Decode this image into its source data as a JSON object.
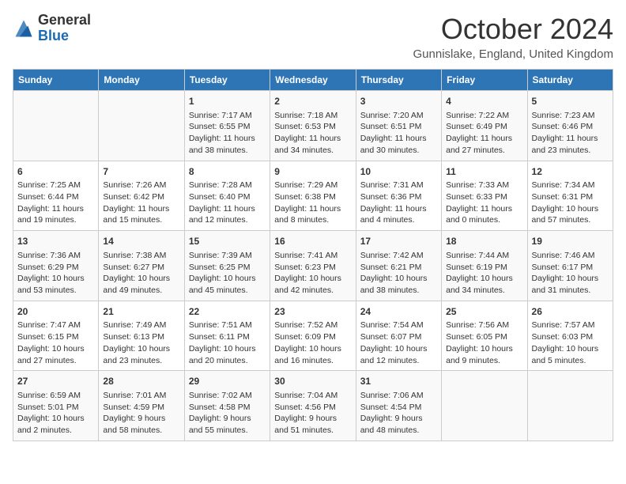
{
  "header": {
    "logo_line1": "General",
    "logo_line2": "Blue",
    "month": "October 2024",
    "location": "Gunnislake, England, United Kingdom"
  },
  "days_of_week": [
    "Sunday",
    "Monday",
    "Tuesday",
    "Wednesday",
    "Thursday",
    "Friday",
    "Saturday"
  ],
  "weeks": [
    [
      {
        "day": "",
        "info": ""
      },
      {
        "day": "",
        "info": ""
      },
      {
        "day": "1",
        "info": "Sunrise: 7:17 AM\nSunset: 6:55 PM\nDaylight: 11 hours and 38 minutes."
      },
      {
        "day": "2",
        "info": "Sunrise: 7:18 AM\nSunset: 6:53 PM\nDaylight: 11 hours and 34 minutes."
      },
      {
        "day": "3",
        "info": "Sunrise: 7:20 AM\nSunset: 6:51 PM\nDaylight: 11 hours and 30 minutes."
      },
      {
        "day": "4",
        "info": "Sunrise: 7:22 AM\nSunset: 6:49 PM\nDaylight: 11 hours and 27 minutes."
      },
      {
        "day": "5",
        "info": "Sunrise: 7:23 AM\nSunset: 6:46 PM\nDaylight: 11 hours and 23 minutes."
      }
    ],
    [
      {
        "day": "6",
        "info": "Sunrise: 7:25 AM\nSunset: 6:44 PM\nDaylight: 11 hours and 19 minutes."
      },
      {
        "day": "7",
        "info": "Sunrise: 7:26 AM\nSunset: 6:42 PM\nDaylight: 11 hours and 15 minutes."
      },
      {
        "day": "8",
        "info": "Sunrise: 7:28 AM\nSunset: 6:40 PM\nDaylight: 11 hours and 12 minutes."
      },
      {
        "day": "9",
        "info": "Sunrise: 7:29 AM\nSunset: 6:38 PM\nDaylight: 11 hours and 8 minutes."
      },
      {
        "day": "10",
        "info": "Sunrise: 7:31 AM\nSunset: 6:36 PM\nDaylight: 11 hours and 4 minutes."
      },
      {
        "day": "11",
        "info": "Sunrise: 7:33 AM\nSunset: 6:33 PM\nDaylight: 11 hours and 0 minutes."
      },
      {
        "day": "12",
        "info": "Sunrise: 7:34 AM\nSunset: 6:31 PM\nDaylight: 10 hours and 57 minutes."
      }
    ],
    [
      {
        "day": "13",
        "info": "Sunrise: 7:36 AM\nSunset: 6:29 PM\nDaylight: 10 hours and 53 minutes."
      },
      {
        "day": "14",
        "info": "Sunrise: 7:38 AM\nSunset: 6:27 PM\nDaylight: 10 hours and 49 minutes."
      },
      {
        "day": "15",
        "info": "Sunrise: 7:39 AM\nSunset: 6:25 PM\nDaylight: 10 hours and 45 minutes."
      },
      {
        "day": "16",
        "info": "Sunrise: 7:41 AM\nSunset: 6:23 PM\nDaylight: 10 hours and 42 minutes."
      },
      {
        "day": "17",
        "info": "Sunrise: 7:42 AM\nSunset: 6:21 PM\nDaylight: 10 hours and 38 minutes."
      },
      {
        "day": "18",
        "info": "Sunrise: 7:44 AM\nSunset: 6:19 PM\nDaylight: 10 hours and 34 minutes."
      },
      {
        "day": "19",
        "info": "Sunrise: 7:46 AM\nSunset: 6:17 PM\nDaylight: 10 hours and 31 minutes."
      }
    ],
    [
      {
        "day": "20",
        "info": "Sunrise: 7:47 AM\nSunset: 6:15 PM\nDaylight: 10 hours and 27 minutes."
      },
      {
        "day": "21",
        "info": "Sunrise: 7:49 AM\nSunset: 6:13 PM\nDaylight: 10 hours and 23 minutes."
      },
      {
        "day": "22",
        "info": "Sunrise: 7:51 AM\nSunset: 6:11 PM\nDaylight: 10 hours and 20 minutes."
      },
      {
        "day": "23",
        "info": "Sunrise: 7:52 AM\nSunset: 6:09 PM\nDaylight: 10 hours and 16 minutes."
      },
      {
        "day": "24",
        "info": "Sunrise: 7:54 AM\nSunset: 6:07 PM\nDaylight: 10 hours and 12 minutes."
      },
      {
        "day": "25",
        "info": "Sunrise: 7:56 AM\nSunset: 6:05 PM\nDaylight: 10 hours and 9 minutes."
      },
      {
        "day": "26",
        "info": "Sunrise: 7:57 AM\nSunset: 6:03 PM\nDaylight: 10 hours and 5 minutes."
      }
    ],
    [
      {
        "day": "27",
        "info": "Sunrise: 6:59 AM\nSunset: 5:01 PM\nDaylight: 10 hours and 2 minutes."
      },
      {
        "day": "28",
        "info": "Sunrise: 7:01 AM\nSunset: 4:59 PM\nDaylight: 9 hours and 58 minutes."
      },
      {
        "day": "29",
        "info": "Sunrise: 7:02 AM\nSunset: 4:58 PM\nDaylight: 9 hours and 55 minutes."
      },
      {
        "day": "30",
        "info": "Sunrise: 7:04 AM\nSunset: 4:56 PM\nDaylight: 9 hours and 51 minutes."
      },
      {
        "day": "31",
        "info": "Sunrise: 7:06 AM\nSunset: 4:54 PM\nDaylight: 9 hours and 48 minutes."
      },
      {
        "day": "",
        "info": ""
      },
      {
        "day": "",
        "info": ""
      }
    ]
  ]
}
